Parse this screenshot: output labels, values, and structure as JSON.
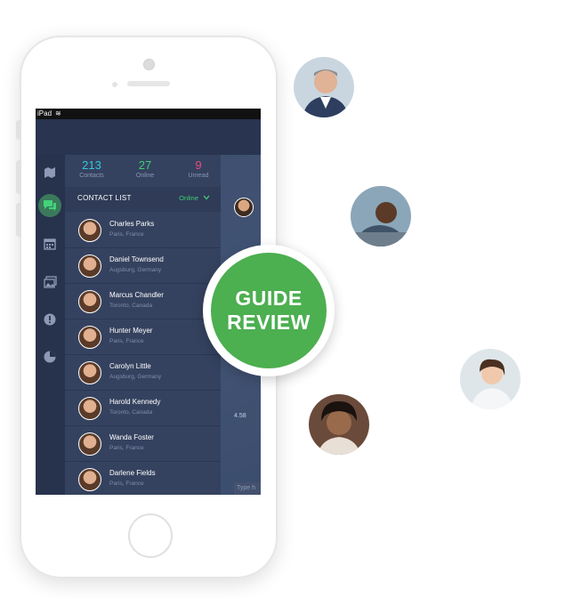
{
  "status_bar": {
    "carrier": "iPad",
    "wifi_icon": "wifi-icon"
  },
  "stats": [
    {
      "value": "213",
      "label": "Contacts",
      "color": "#33c9dc"
    },
    {
      "value": "27",
      "label": "Online",
      "color": "#3fce76"
    },
    {
      "value": "9",
      "label": "Unread",
      "color": "#e84c7c"
    }
  ],
  "nav_icons": [
    "map-icon",
    "chat-icon",
    "calendar-icon",
    "photos-icon",
    "alert-icon",
    "pie-chart-icon"
  ],
  "contact_list": {
    "title": "CONTACT LIST",
    "status_filter": "Online",
    "contacts": [
      {
        "name": "Charles Parks",
        "location": "Paris, France"
      },
      {
        "name": "Daniel Townsend",
        "location": "Augsburg, Germany"
      },
      {
        "name": "Marcus Chandler",
        "location": "Toronto, Canada"
      },
      {
        "name": "Hunter Meyer",
        "location": "Paris, France"
      },
      {
        "name": "Carolyn Little",
        "location": "Augsburg, Germany"
      },
      {
        "name": "Harold Kennedy",
        "location": "Toronto, Canada"
      },
      {
        "name": "Wanda Foster",
        "location": "Paris, France"
      },
      {
        "name": "Darlene Fields",
        "location": "Paris, France"
      }
    ]
  },
  "chat": {
    "time": "4.58",
    "input_placeholder": "Type h"
  },
  "badge": {
    "line1": "GUIDE",
    "line2": "REVIEW",
    "color": "#4caf50"
  }
}
